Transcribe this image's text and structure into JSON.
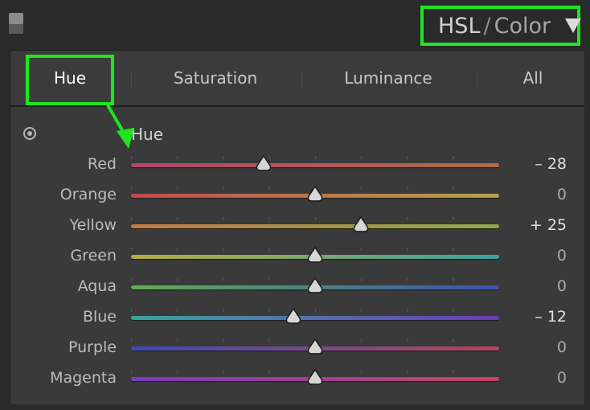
{
  "header": {
    "title_hsl": "HSL",
    "title_sep": "/",
    "title_color": "Color"
  },
  "tabs": [
    {
      "label": "Hue",
      "active": true
    },
    {
      "label": "Saturation",
      "active": false
    },
    {
      "label": "Luminance",
      "active": false
    },
    {
      "label": "All",
      "active": false
    }
  ],
  "section": {
    "title": "Hue"
  },
  "sliders": [
    {
      "label": "Red",
      "value": -28,
      "display": "– 28",
      "colors": [
        "#b0456b",
        "#b26b47"
      ]
    },
    {
      "label": "Orange",
      "value": 0,
      "display": "0",
      "colors": [
        "#c44a4a",
        "#b5a24a"
      ]
    },
    {
      "label": "Yellow",
      "value": 25,
      "display": "+ 25",
      "colors": [
        "#c27a43",
        "#8eaa45"
      ]
    },
    {
      "label": "Green",
      "value": 0,
      "display": "0",
      "colors": [
        "#b5ad3e",
        "#3aa3a0"
      ]
    },
    {
      "label": "Aqua",
      "value": 0,
      "display": "0",
      "colors": [
        "#5fae55",
        "#3b52b0"
      ]
    },
    {
      "label": "Blue",
      "value": -12,
      "display": "– 12",
      "colors": [
        "#3aa3a0",
        "#6a3cb8"
      ]
    },
    {
      "label": "Purple",
      "value": 0,
      "display": "0",
      "colors": [
        "#3b4bb8",
        "#b8445a"
      ]
    },
    {
      "label": "Magenta",
      "value": 0,
      "display": "0",
      "colors": [
        "#7a3cc0",
        "#c44662"
      ]
    }
  ],
  "slider_range": [
    -100,
    100
  ],
  "accent_highlight": "#1ee61e"
}
